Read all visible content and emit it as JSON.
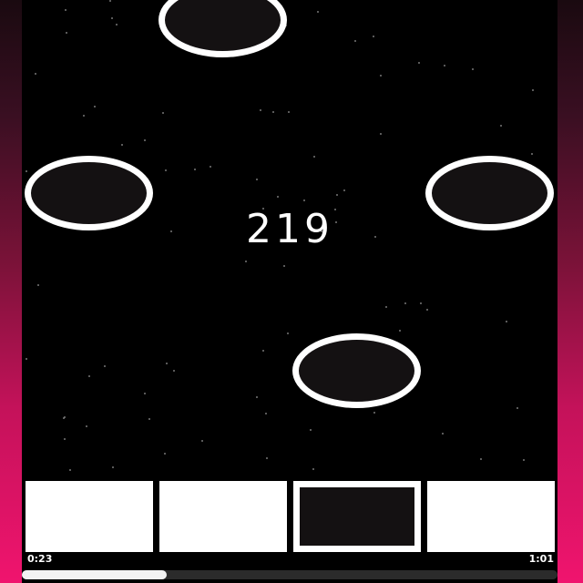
{
  "game": {
    "score": "219",
    "lanes": [
      {
        "name": "lane-1",
        "state": "idle"
      },
      {
        "name": "lane-2",
        "state": "idle"
      },
      {
        "name": "lane-3",
        "state": "active"
      },
      {
        "name": "lane-4",
        "state": "idle"
      }
    ]
  },
  "player": {
    "elapsed": "0:23",
    "duration": "1:01",
    "progress": 0.27
  },
  "colors": {
    "background": "#000000",
    "note": "#141112",
    "note_ring": "#ffffff",
    "accent": "#f0146e"
  }
}
